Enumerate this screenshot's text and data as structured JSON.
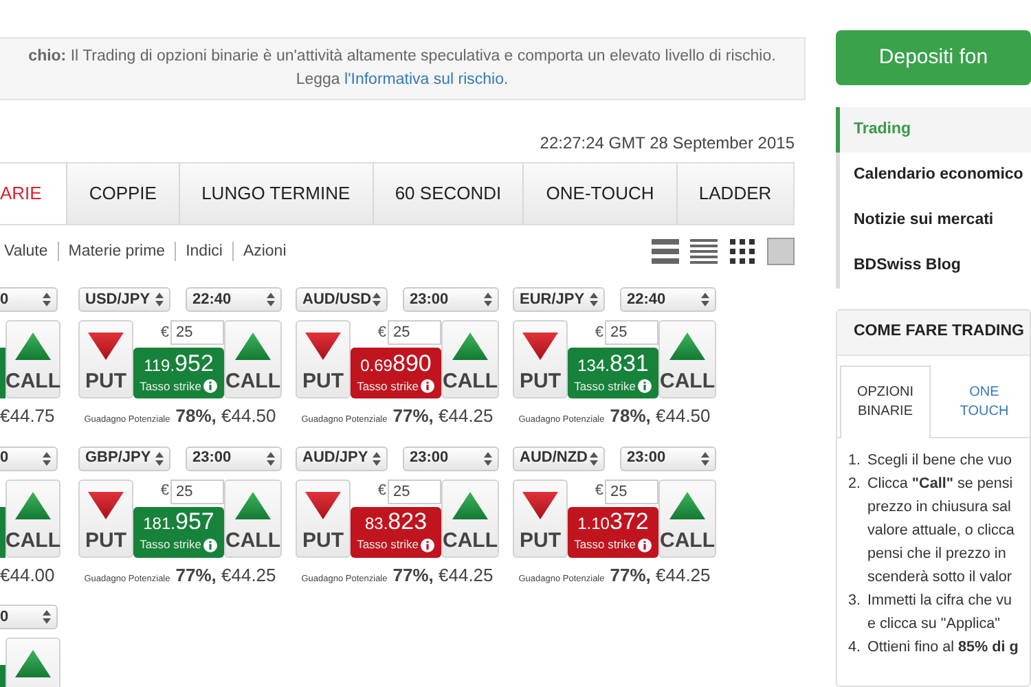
{
  "risk_notice": {
    "label": "chio:",
    "text": "Il Trading di opzioni binarie è un'attività  altamente speculativa e comporta un elevato livello di rischio. Legga ",
    "link": "l'Informativa sul rischio."
  },
  "clock": "22:27:24 GMT 28 September 2015",
  "tabs": [
    {
      "label": "ARIE",
      "selected": true
    },
    {
      "label": "COPPIE",
      "selected": false
    },
    {
      "label": "LUNGO TERMINE",
      "selected": false
    },
    {
      "label": "60 SECONDI",
      "selected": false
    },
    {
      "label": "ONE-TOUCH",
      "selected": false
    },
    {
      "label": "LADDER",
      "selected": false
    }
  ],
  "filters": [
    "Valute",
    "Materie prime",
    "Indici",
    "Azioni"
  ],
  "view_options": [
    {
      "kind": "list",
      "selected": false
    },
    {
      "kind": "compact",
      "selected": false
    },
    {
      "kind": "grid",
      "selected": false
    },
    {
      "kind": "tile",
      "selected": true
    }
  ],
  "option_rows": [
    {
      "cards": [
        {
          "kind": "cut",
          "time": "0",
          "color": "#17823a",
          "call": "CALL",
          "payout": "€44.75"
        },
        {
          "kind": "full",
          "asset": "USD/JPY",
          "time": "22:40",
          "currency": "€",
          "amount": "25",
          "price_head": "119.",
          "price_tail": "952",
          "strike_label": "Tasso strike",
          "color": "#17823a",
          "put": "PUT",
          "call": "CALL",
          "payout_label": "Guadagno Potenziale",
          "payout": "**78%,** €44.50"
        },
        {
          "kind": "full",
          "asset": "AUD/USD",
          "time": "23:00",
          "currency": "€",
          "amount": "25",
          "price_head": "0.69",
          "price_tail": "890",
          "strike_label": "Tasso strike",
          "color": "#c0141f",
          "put": "PUT",
          "call": "CALL",
          "payout_label": "Guadagno Potenziale",
          "payout": "**77%,** €44.25"
        },
        {
          "kind": "full",
          "asset": "EUR/JPY",
          "time": "22:40",
          "currency": "€",
          "amount": "25",
          "price_head": "134.",
          "price_tail": "831",
          "strike_label": "Tasso strike",
          "color": "#17823a",
          "put": "PUT",
          "call": "CALL",
          "payout_label": "Guadagno Potenziale",
          "payout": "**78%,** €44.50"
        }
      ]
    },
    {
      "cards": [
        {
          "kind": "cut",
          "time": "0",
          "color": "#17823a",
          "call": "CALL",
          "payout": "€44.00"
        },
        {
          "kind": "full",
          "asset": "GBP/JPY",
          "time": "23:00",
          "currency": "€",
          "amount": "25",
          "price_head": "181.",
          "price_tail": "957",
          "strike_label": "Tasso strike",
          "color": "#17823a",
          "put": "PUT",
          "call": "CALL",
          "payout_label": "Guadagno Potenziale",
          "payout": "**77%,** €44.25"
        },
        {
          "kind": "full",
          "asset": "AUD/JPY",
          "time": "23:00",
          "currency": "€",
          "amount": "25",
          "price_head": "83.",
          "price_tail": "823",
          "strike_label": "Tasso strike",
          "color": "#c0141f",
          "put": "PUT",
          "call": "CALL",
          "payout_label": "Guadagno Potenziale",
          "payout": "**77%,** €44.25"
        },
        {
          "kind": "full",
          "asset": "AUD/NZD",
          "time": "23:00",
          "currency": "€",
          "amount": "25",
          "price_head": "1.10",
          "price_tail": "372",
          "strike_label": "Tasso strike",
          "color": "#c0141f",
          "put": "PUT",
          "call": "CALL",
          "payout_label": "Guadagno Potenziale",
          "payout": "**77%,** €44.25"
        }
      ]
    },
    {
      "cards": [
        {
          "kind": "cut",
          "time": "0",
          "color": "#17823a"
        }
      ]
    }
  ],
  "sidebar": {
    "deposit_button": "Depositi fon",
    "menu": [
      {
        "label": "Trading",
        "selected": true
      },
      {
        "label": "Calendario economico",
        "selected": false
      },
      {
        "label": "Notizie sui mercati",
        "selected": false
      },
      {
        "label": "BDSwiss Blog",
        "selected": false
      }
    ],
    "how_to": {
      "title": "COME FARE TRADING",
      "tabs": [
        {
          "label": "OPZIONI BINARIE",
          "selected": true
        },
        {
          "label": "ONE TOUCH",
          "selected": false
        }
      ],
      "steps": [
        {
          "number": "1.",
          "lines": [
            "Scegli il bene che vuo"
          ]
        },
        {
          "number": "2.",
          "lines": [
            "Clicca **\"Call\"** se pensi",
            "prezzo in chiusura sal",
            "valore attuale, o clicca",
            "pensi che il prezzo in",
            "scenderà sotto il valor"
          ]
        },
        {
          "number": "3.",
          "lines": [
            "Immetti la cifra che vu",
            "e clicca su \"Applica\""
          ]
        },
        {
          "number": "4.",
          "lines": [
            "Ottieni fino al **85% di g**"
          ]
        }
      ]
    }
  }
}
